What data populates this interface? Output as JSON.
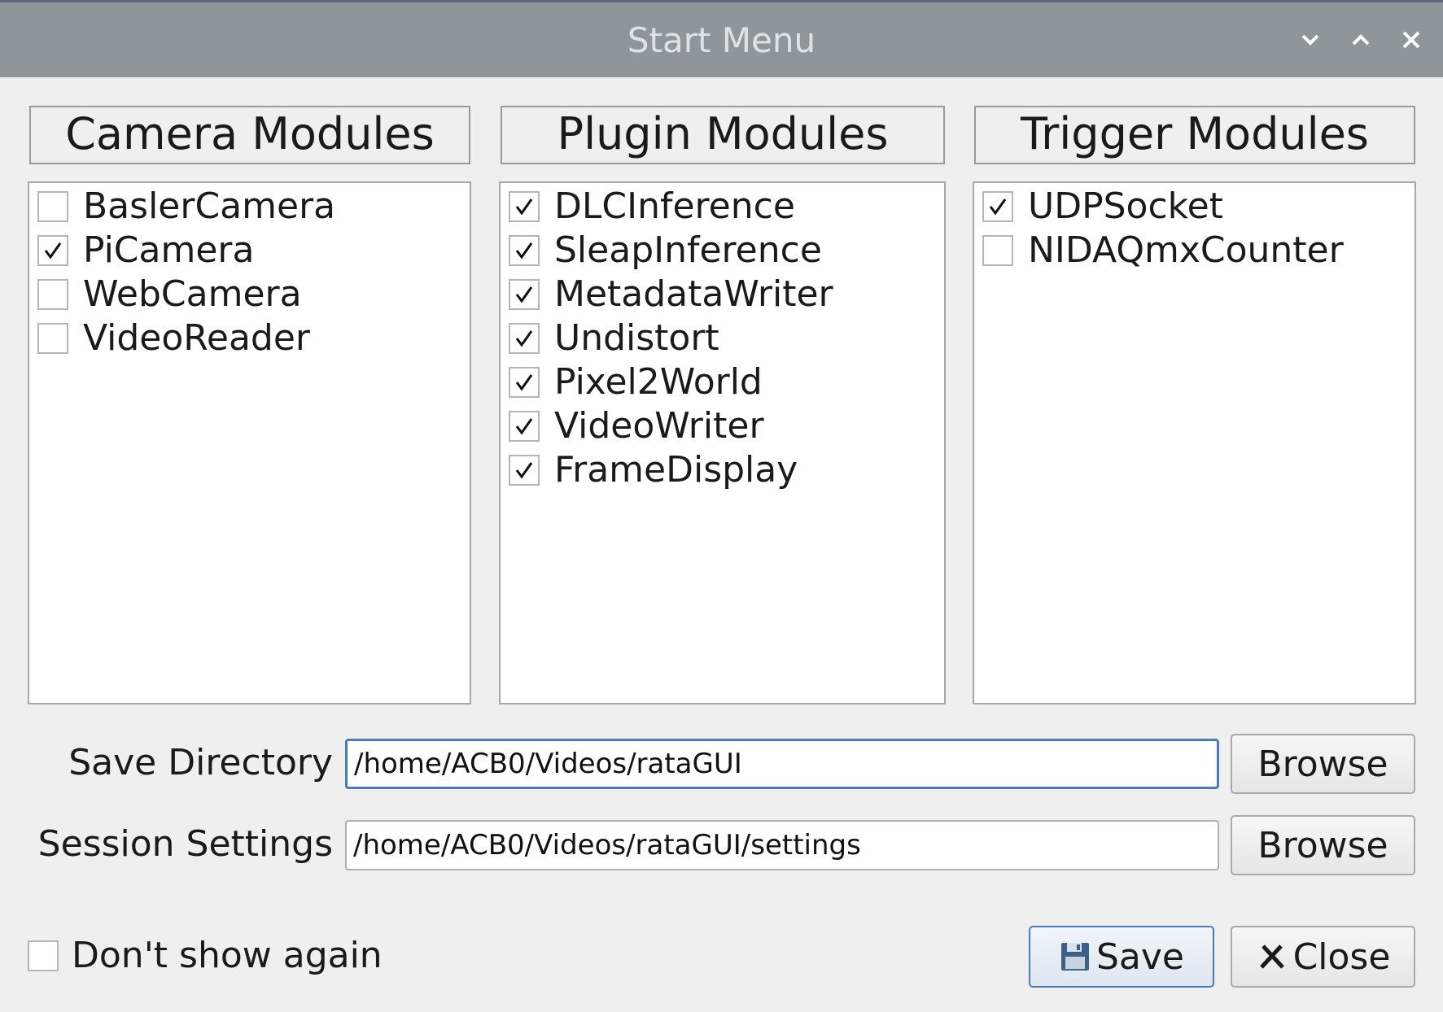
{
  "window": {
    "title": "Start Menu"
  },
  "camera": {
    "header": "Camera Modules",
    "items": [
      {
        "label": "BaslerCamera",
        "checked": false
      },
      {
        "label": "PiCamera",
        "checked": true
      },
      {
        "label": "WebCamera",
        "checked": false
      },
      {
        "label": "VideoReader",
        "checked": false
      }
    ]
  },
  "plugin": {
    "header": "Plugin Modules",
    "items": [
      {
        "label": "DLCInference",
        "checked": true
      },
      {
        "label": "SleapInference",
        "checked": true
      },
      {
        "label": "MetadataWriter",
        "checked": true
      },
      {
        "label": "Undistort",
        "checked": true
      },
      {
        "label": "Pixel2World",
        "checked": true
      },
      {
        "label": "VideoWriter",
        "checked": true
      },
      {
        "label": "FrameDisplay",
        "checked": true
      }
    ]
  },
  "trigger": {
    "header": "Trigger Modules",
    "items": [
      {
        "label": "UDPSocket",
        "checked": true
      },
      {
        "label": "NIDAQmxCounter",
        "checked": false
      }
    ]
  },
  "save_directory": {
    "label": "Save Directory",
    "value": "/home/ACB0/Videos/rataGUI",
    "browse_label": "Browse"
  },
  "session_settings": {
    "label": "Session Settings",
    "value": "/home/ACB0/Videos/rataGUI/settings",
    "browse_label": "Browse"
  },
  "dont_show": {
    "label": "Don't show again",
    "checked": false
  },
  "buttons": {
    "save_label": "Save",
    "close_label": "Close"
  }
}
